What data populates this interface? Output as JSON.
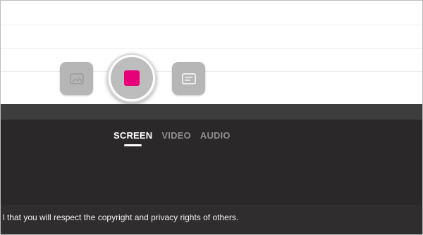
{
  "capture": {
    "tabs": [
      {
        "label": "SCREEN",
        "active": true
      },
      {
        "label": "VIDEO",
        "active": false
      },
      {
        "label": "AUDIO",
        "active": false
      }
    ],
    "buttons": {
      "photo_icon": "photo-icon",
      "record_icon": "stop-square-icon",
      "notes_icon": "notes-icon"
    },
    "record_color": "#e6007a"
  },
  "footer": {
    "text": "l that you will respect the copyright and privacy rights of others."
  }
}
